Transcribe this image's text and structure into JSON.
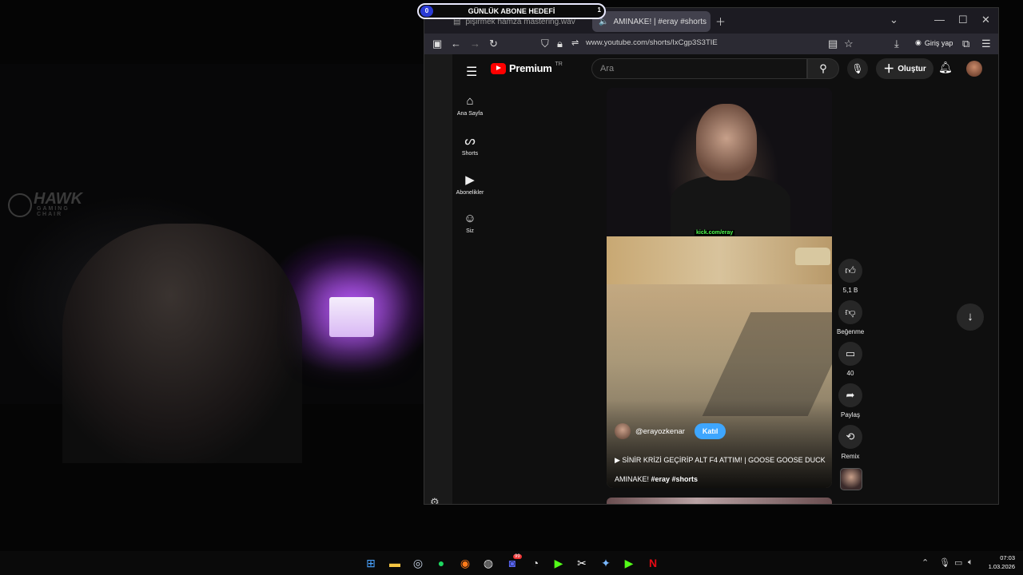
{
  "stream": {
    "goal_label": "GÜNLÜK ABONE HEDEFİ",
    "goal_current": "0",
    "goal_target": "1",
    "watermark_logo": "HAWK",
    "watermark_sub": "GAMING CHAIR"
  },
  "browser": {
    "tabs": [
      {
        "label": "pişirmek hamza mastering.wav",
        "active": false
      },
      {
        "label": "AMINAKE! | #eray #shorts",
        "active": true
      }
    ],
    "url": "www.youtube.com/shorts/IxCgp3S3TIE",
    "signin_label": "Giriş yap"
  },
  "youtube": {
    "logo_text": "Premium",
    "region": "TR",
    "search_placeholder": "Ara",
    "create_label": "Oluştur",
    "sidebar": [
      {
        "label": "Ana Sayfa",
        "icon": "home-icon"
      },
      {
        "label": "Shorts",
        "icon": "shorts-icon"
      },
      {
        "label": "Abonelikler",
        "icon": "subscriptions-icon"
      },
      {
        "label": "Siz",
        "icon": "you-icon"
      }
    ],
    "short": {
      "overlay_text": "kick.com/eray",
      "channel": "@erayozkenar",
      "join_label": "Katıl",
      "title_line": "SİNİR KRİZİ GEÇİRİP ALT F4 ATTIM! | GOOSE GOOSE DUCK",
      "title_rest": "AMINAKE! ",
      "hashtags": "#eray #shorts"
    },
    "actions": {
      "like_count": "5,1 B",
      "dislike_label": "Beğenme",
      "comment_count": "40",
      "share_label": "Paylaş",
      "remix_label": "Remix"
    }
  },
  "taskbar": {
    "time": "07:03",
    "date": "1.03.2026",
    "discord_badge": "99"
  }
}
